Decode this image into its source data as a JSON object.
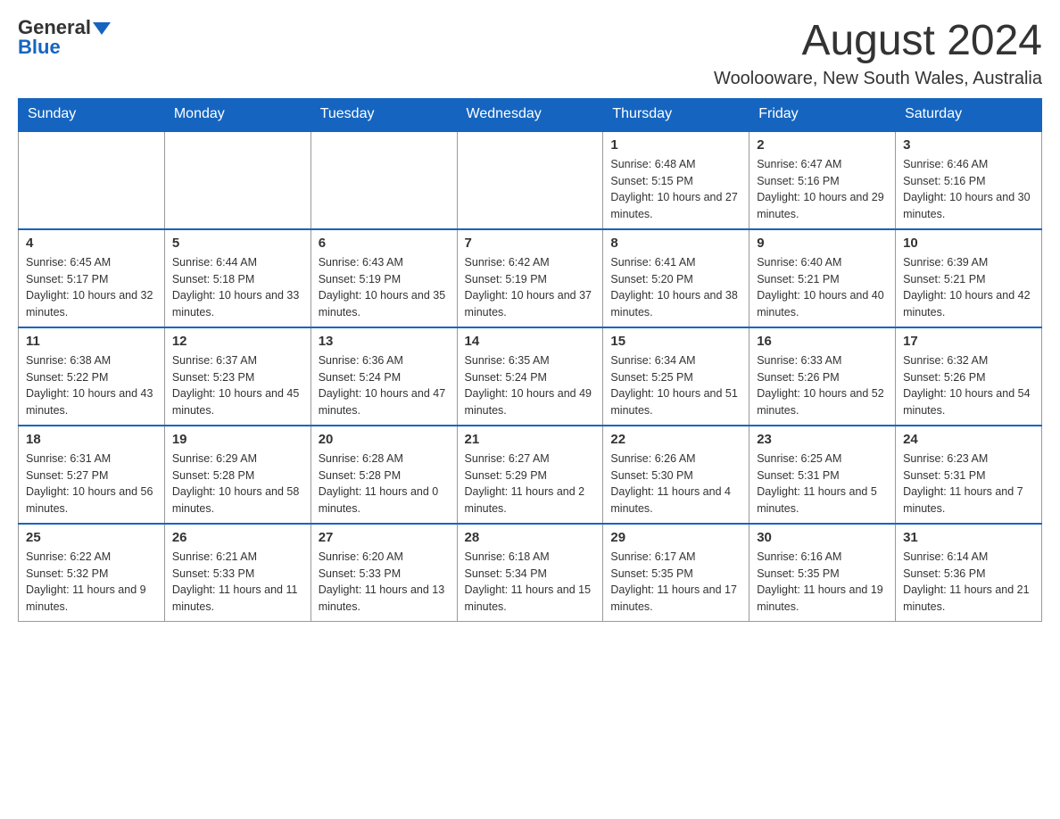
{
  "header": {
    "logo_general": "General",
    "logo_blue": "Blue",
    "month_title": "August 2024",
    "location": "Woolooware, New South Wales, Australia"
  },
  "days_of_week": [
    "Sunday",
    "Monday",
    "Tuesday",
    "Wednesday",
    "Thursday",
    "Friday",
    "Saturday"
  ],
  "weeks": [
    [
      {
        "day": "",
        "info": ""
      },
      {
        "day": "",
        "info": ""
      },
      {
        "day": "",
        "info": ""
      },
      {
        "day": "",
        "info": ""
      },
      {
        "day": "1",
        "info": "Sunrise: 6:48 AM\nSunset: 5:15 PM\nDaylight: 10 hours and 27 minutes."
      },
      {
        "day": "2",
        "info": "Sunrise: 6:47 AM\nSunset: 5:16 PM\nDaylight: 10 hours and 29 minutes."
      },
      {
        "day": "3",
        "info": "Sunrise: 6:46 AM\nSunset: 5:16 PM\nDaylight: 10 hours and 30 minutes."
      }
    ],
    [
      {
        "day": "4",
        "info": "Sunrise: 6:45 AM\nSunset: 5:17 PM\nDaylight: 10 hours and 32 minutes."
      },
      {
        "day": "5",
        "info": "Sunrise: 6:44 AM\nSunset: 5:18 PM\nDaylight: 10 hours and 33 minutes."
      },
      {
        "day": "6",
        "info": "Sunrise: 6:43 AM\nSunset: 5:19 PM\nDaylight: 10 hours and 35 minutes."
      },
      {
        "day": "7",
        "info": "Sunrise: 6:42 AM\nSunset: 5:19 PM\nDaylight: 10 hours and 37 minutes."
      },
      {
        "day": "8",
        "info": "Sunrise: 6:41 AM\nSunset: 5:20 PM\nDaylight: 10 hours and 38 minutes."
      },
      {
        "day": "9",
        "info": "Sunrise: 6:40 AM\nSunset: 5:21 PM\nDaylight: 10 hours and 40 minutes."
      },
      {
        "day": "10",
        "info": "Sunrise: 6:39 AM\nSunset: 5:21 PM\nDaylight: 10 hours and 42 minutes."
      }
    ],
    [
      {
        "day": "11",
        "info": "Sunrise: 6:38 AM\nSunset: 5:22 PM\nDaylight: 10 hours and 43 minutes."
      },
      {
        "day": "12",
        "info": "Sunrise: 6:37 AM\nSunset: 5:23 PM\nDaylight: 10 hours and 45 minutes."
      },
      {
        "day": "13",
        "info": "Sunrise: 6:36 AM\nSunset: 5:24 PM\nDaylight: 10 hours and 47 minutes."
      },
      {
        "day": "14",
        "info": "Sunrise: 6:35 AM\nSunset: 5:24 PM\nDaylight: 10 hours and 49 minutes."
      },
      {
        "day": "15",
        "info": "Sunrise: 6:34 AM\nSunset: 5:25 PM\nDaylight: 10 hours and 51 minutes."
      },
      {
        "day": "16",
        "info": "Sunrise: 6:33 AM\nSunset: 5:26 PM\nDaylight: 10 hours and 52 minutes."
      },
      {
        "day": "17",
        "info": "Sunrise: 6:32 AM\nSunset: 5:26 PM\nDaylight: 10 hours and 54 minutes."
      }
    ],
    [
      {
        "day": "18",
        "info": "Sunrise: 6:31 AM\nSunset: 5:27 PM\nDaylight: 10 hours and 56 minutes."
      },
      {
        "day": "19",
        "info": "Sunrise: 6:29 AM\nSunset: 5:28 PM\nDaylight: 10 hours and 58 minutes."
      },
      {
        "day": "20",
        "info": "Sunrise: 6:28 AM\nSunset: 5:28 PM\nDaylight: 11 hours and 0 minutes."
      },
      {
        "day": "21",
        "info": "Sunrise: 6:27 AM\nSunset: 5:29 PM\nDaylight: 11 hours and 2 minutes."
      },
      {
        "day": "22",
        "info": "Sunrise: 6:26 AM\nSunset: 5:30 PM\nDaylight: 11 hours and 4 minutes."
      },
      {
        "day": "23",
        "info": "Sunrise: 6:25 AM\nSunset: 5:31 PM\nDaylight: 11 hours and 5 minutes."
      },
      {
        "day": "24",
        "info": "Sunrise: 6:23 AM\nSunset: 5:31 PM\nDaylight: 11 hours and 7 minutes."
      }
    ],
    [
      {
        "day": "25",
        "info": "Sunrise: 6:22 AM\nSunset: 5:32 PM\nDaylight: 11 hours and 9 minutes."
      },
      {
        "day": "26",
        "info": "Sunrise: 6:21 AM\nSunset: 5:33 PM\nDaylight: 11 hours and 11 minutes."
      },
      {
        "day": "27",
        "info": "Sunrise: 6:20 AM\nSunset: 5:33 PM\nDaylight: 11 hours and 13 minutes."
      },
      {
        "day": "28",
        "info": "Sunrise: 6:18 AM\nSunset: 5:34 PM\nDaylight: 11 hours and 15 minutes."
      },
      {
        "day": "29",
        "info": "Sunrise: 6:17 AM\nSunset: 5:35 PM\nDaylight: 11 hours and 17 minutes."
      },
      {
        "day": "30",
        "info": "Sunrise: 6:16 AM\nSunset: 5:35 PM\nDaylight: 11 hours and 19 minutes."
      },
      {
        "day": "31",
        "info": "Sunrise: 6:14 AM\nSunset: 5:36 PM\nDaylight: 11 hours and 21 minutes."
      }
    ]
  ]
}
